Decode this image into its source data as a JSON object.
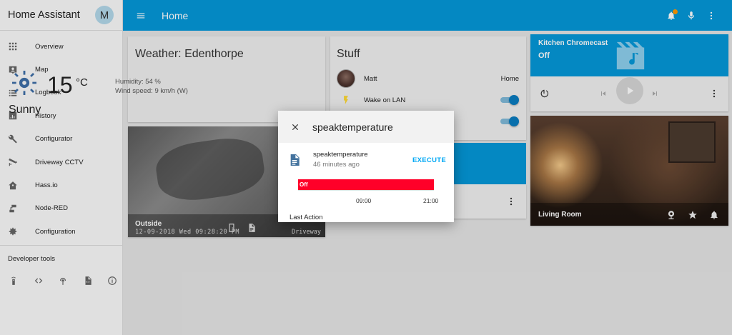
{
  "sidebar": {
    "title": "Home Assistant",
    "avatar_letter": "M",
    "items": [
      {
        "label": "Overview",
        "icon": "grid-icon"
      },
      {
        "label": "Map",
        "icon": "map-account-icon"
      },
      {
        "label": "Logbook",
        "icon": "list-icon"
      },
      {
        "label": "History",
        "icon": "chart-bar-icon"
      },
      {
        "label": "Configurator",
        "icon": "wrench-icon"
      },
      {
        "label": "Driveway CCTV",
        "icon": "cctv-icon"
      },
      {
        "label": "Hass.io",
        "icon": "home-assistant-icon"
      },
      {
        "label": "Node-RED",
        "icon": "sitemap-icon"
      },
      {
        "label": "Configuration",
        "icon": "gear-icon"
      }
    ],
    "dev_tools_title": "Developer tools",
    "dev_tools": [
      "remote-icon",
      "code-icon",
      "broadcast-icon",
      "file-code-icon",
      "info-icon"
    ]
  },
  "topbar": {
    "title": "Home",
    "notification_badge_color": "#ff9800"
  },
  "colors": {
    "primary": "#0598d9",
    "timeline_off": "#ff0029",
    "execute": "#03a9f4"
  },
  "weather": {
    "title": "Weather: Edenthorpe",
    "temperature": "15",
    "unit": "°C",
    "humidity": "Humidity: 54 %",
    "wind": "Wind speed: 9 km/h (W)",
    "condition": "Sunny"
  },
  "camera_outside": {
    "name": "Outside",
    "timestamp": "12-09-2018 Wed 09:28:20 PM",
    "source": "Driveway"
  },
  "stuff": {
    "title": "Stuff",
    "rows": [
      {
        "name": "Matt",
        "state": "Home"
      },
      {
        "name": "Wake on LAN",
        "state": "on"
      }
    ]
  },
  "chromecast": {
    "name": "Kitchen Chromecast",
    "state": "Off"
  },
  "living_room": {
    "name": "Living Room"
  },
  "dialog": {
    "title": "speaktemperature",
    "entity_name": "speaktemperature",
    "last_changed": "46 minutes ago",
    "action_label": "EXECUTE",
    "timeline_state": "Off",
    "ticks": [
      "09:00",
      "21:00"
    ],
    "attribute_label": "Last Action"
  }
}
